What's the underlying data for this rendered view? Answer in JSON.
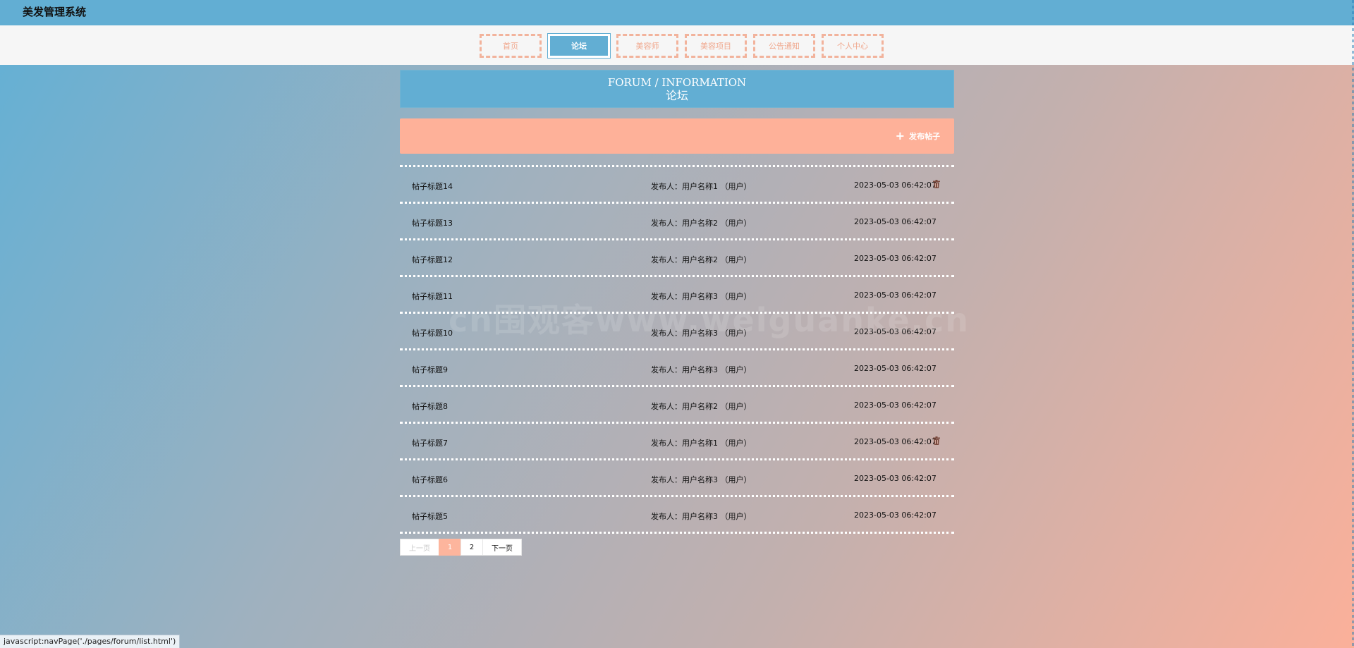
{
  "app": {
    "title": "美发管理系统"
  },
  "nav": {
    "items": [
      {
        "label": "首页",
        "active": false
      },
      {
        "label": "论坛",
        "active": true
      },
      {
        "label": "美容师",
        "active": false
      },
      {
        "label": "美容项目",
        "active": false
      },
      {
        "label": "公告通知",
        "active": false
      },
      {
        "label": "个人中心",
        "active": false
      }
    ]
  },
  "page": {
    "title_en": "FORUM / INFORMATION",
    "title_cn": "论坛"
  },
  "actions": {
    "post_label": "发布帖子",
    "post_icon": "plus-icon"
  },
  "posts": [
    {
      "title": "帖子标题14",
      "author": "发布人：用户名称1 （用户）",
      "time": "2023-05-03 06:42:07",
      "deletable": true
    },
    {
      "title": "帖子标题13",
      "author": "发布人：用户名称2 （用户）",
      "time": "2023-05-03 06:42:07",
      "deletable": false
    },
    {
      "title": "帖子标题12",
      "author": "发布人：用户名称2 （用户）",
      "time": "2023-05-03 06:42:07",
      "deletable": false
    },
    {
      "title": "帖子标题11",
      "author": "发布人：用户名称3 （用户）",
      "time": "2023-05-03 06:42:07",
      "deletable": false
    },
    {
      "title": "帖子标题10",
      "author": "发布人：用户名称3 （用户）",
      "time": "2023-05-03 06:42:07",
      "deletable": false
    },
    {
      "title": "帖子标题9",
      "author": "发布人：用户名称3 （用户）",
      "time": "2023-05-03 06:42:07",
      "deletable": false
    },
    {
      "title": "帖子标题8",
      "author": "发布人：用户名称2 （用户）",
      "time": "2023-05-03 06:42:07",
      "deletable": false
    },
    {
      "title": "帖子标题7",
      "author": "发布人：用户名称1 （用户）",
      "time": "2023-05-03 06:42:07",
      "deletable": true
    },
    {
      "title": "帖子标题6",
      "author": "发布人：用户名称3 （用户）",
      "time": "2023-05-03 06:42:07",
      "deletable": false
    },
    {
      "title": "帖子标题5",
      "author": "发布人：用户名称3 （用户）",
      "time": "2023-05-03 06:42:07",
      "deletable": false
    }
  ],
  "pagination": {
    "prev_label": "上一页",
    "next_label": "下一页",
    "pages": [
      "1",
      "2"
    ],
    "current": "1"
  },
  "watermark": "cn围观客www.weiguanke.cn",
  "status_bar": {
    "url": "javascript:navPage('./pages/forum/list.html')"
  },
  "colors": {
    "topbar": "#62aed3",
    "accent": "#feb199",
    "nav_border": "#f2b39c"
  }
}
